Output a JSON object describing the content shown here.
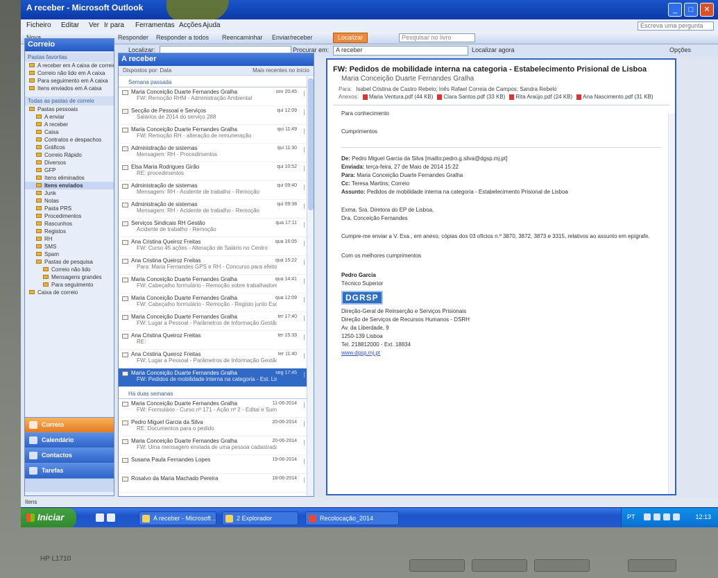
{
  "window": {
    "title": "A receber - Microsoft Outlook"
  },
  "menubar": {
    "items": [
      "Ficheiro",
      "Editar",
      "Ver",
      "Ir para",
      "Ferramentas",
      "Acções",
      "Ajuda"
    ],
    "help_placeholder": "Escreva uma pergunta"
  },
  "toolbar": {
    "new_label": "Nova",
    "reply_label": "Responder",
    "reply_all_label": "Responder a todos",
    "forward_label": "Reencaminhar",
    "send_receive_label": "Enviar/receber",
    "active_label": "Localizar",
    "search_placeholder": "Pesquisar no livro"
  },
  "findbar": {
    "search_label": "Localizar:",
    "search_in_label": "Procurar em:",
    "search_in_value": "A receber",
    "find_now_label": "Localizar agora",
    "options_label": "Opções"
  },
  "nav": {
    "header": "Correio",
    "favorites_title": "Pastas favoritas",
    "favorites": [
      "A receber em A caixa de correio",
      "Correio não lido em A caixa",
      "Para seguimento em A caixa",
      "Itens enviados em A caixa"
    ],
    "all_folders_title": "Todas as pastas de correio",
    "tree": [
      "Pastas pessoais",
      "A enviar",
      "A receber",
      "Caixa",
      "Contratos e despachos",
      "Gráficos",
      "Correio Rápido",
      "Diversos",
      "GFP",
      "Itens eliminados",
      "Itens enviados",
      "Junk",
      "Notas",
      "Pasta PRS",
      "Procedimentos",
      "Rascunhos",
      "Registos",
      "RH",
      "SMS",
      "Spam",
      "Pastas de pesquisa",
      "Correio não lido",
      "Mensagens grandes",
      "Para seguimento",
      "Caixa de correio"
    ],
    "selected_index": 10,
    "buttons": [
      "Correio",
      "Calendário",
      "Contactos",
      "Tarefas"
    ]
  },
  "list": {
    "header": "A receber",
    "arrange_label": "Dispostos por: Data",
    "sort_label": "Mais recentes no início",
    "groups": [
      {
        "label": "Semana passada",
        "messages": [
          {
            "from": "Maria Conceição Duarte Fernandes Gralha",
            "subject": "FW: Remoção RHM - Administração Ambiental",
            "date": "sex 20:45"
          },
          {
            "from": "Secção de Pessoal e Serviços",
            "subject": "Salários de 2014 do serviço 288",
            "date": "qui 12:09"
          },
          {
            "from": "Maria Conceição Duarte Fernandes Gralha",
            "subject": "FW: Remoção RH - alteração de remuneração",
            "date": "qui 11:49"
          },
          {
            "from": "Administração de sistemas",
            "subject": "Mensagem: RH - Procedimentos",
            "date": "qui 11:30"
          },
          {
            "from": "Elsa Maria Rodrigues Girão",
            "subject": "RE: procedimentos",
            "date": "qui 10:52"
          },
          {
            "from": "Administração de sistemas",
            "subject": "Mensagem: RH - Acidente de trabalho - Remoção",
            "date": "qui 09:40"
          },
          {
            "from": "Administração de sistemas",
            "subject": "Mensagem: RH - Acidente de trabalho - Remoção",
            "date": "qui 09:38"
          },
          {
            "from": "Serviços Sindicais RH Gestão",
            "subject": "Acidente de trabalho - Remoção",
            "date": "qua 17:11"
          },
          {
            "from": "Ana Cristina Queiroz Freitas",
            "subject": "FW: Curso 45 ações - Alteração de Salário no Centro",
            "date": "qua 16:05"
          },
          {
            "from": "Ana Cristina Queiroz Freitas",
            "subject": "Para: Maria Fernandes GPS e RH - Concurso para efeito",
            "date": "qua 15:22"
          },
          {
            "from": "Maria Conceição Duarte Fernandes Gralha",
            "subject": "FW: Cabeçalho formulário - Remoção sobre trabalhadores RH",
            "date": "qua 14:41"
          },
          {
            "from": "Maria Conceição Duarte Fernandes Gralha",
            "subject": "FW: Cabeçalho formulário - Remoção - Registo junto Escop",
            "date": "qua 12:09"
          },
          {
            "from": "Maria Conceição Duarte Fernandes Gralha",
            "subject": "FW: Lugar a Pessoal - Parâmetros de Informação Gestão",
            "date": "ter 17:40"
          },
          {
            "from": "Ana Cristina Queiroz Freitas",
            "subject": "RE:",
            "date": "ter 15:33"
          },
          {
            "from": "Ana Cristina Queiroz Freitas",
            "subject": "FW: Lugar a Pessoal - Parâmetros de Informação Gestão",
            "date": "ter 11:40"
          },
          {
            "from": "Maria Conceição Duarte Fernandes Gralha",
            "subject": "FW: Pedidos de mobilidade interna na categoria - Est. Lisboa",
            "date": "seg 17:45",
            "selected": true
          }
        ]
      },
      {
        "label": "Há duas semanas",
        "messages": [
          {
            "from": "Maria Conceição Duarte Fernandes Gralha",
            "subject": "FW: Formulário - Curso nº 171 - Ação nº 2 - Edital e Sum",
            "date": "11-06-2014"
          },
          {
            "from": "Pedro Miguel Garcia da Silva",
            "subject": "RE: Documentos para o pedido",
            "date": "20-06-2014"
          },
          {
            "from": "Maria Conceição Duarte Fernandes Gralha",
            "subject": "FW: Uma mensagem enviada de uma pessoa cadastrada em RH",
            "date": "20-06-2014"
          },
          {
            "from": "Susana Paula Fernandes Lopes",
            "subject": "",
            "date": "19-06-2014"
          },
          {
            "from": "Rosalvo da Maria Machado Pereira",
            "subject": "",
            "date": "18-06-2014"
          }
        ]
      }
    ]
  },
  "reading": {
    "title": "FW: Pedidos de mobilidade interna na categoria - Estabelecimento Prisional de Lisboa",
    "from": "Maria Conceição Duarte Fernandes Gralha",
    "to_label": "Para:",
    "to": "Isabel Cristina de Castro Rebelo; Inês Rafael Correia de Campos; Sandra Rebelo",
    "att_label": "Anexos:",
    "attachments": [
      "Maria Ventura.pdf (44 KB)",
      "Clara Santos.pdf (33 KB)",
      "Rita Araújo.pdf (24 KB)",
      "Ana Nascimento.pdf (31 KB)"
    ],
    "note1": "Para conhecimento",
    "note2": "Cumprimentos",
    "orig_from_label": "De:",
    "orig_from": "Pedro Miguel Garcia da Silva [mailto:pedro.g.silva@dgsp.mj.pt]",
    "orig_sent_label": "Enviada:",
    "orig_sent": "terça-feira, 27 de Maio de 2014 15:22",
    "orig_to_label": "Para:",
    "orig_to": "Maria Conceição Duarte Fernandes Gralha",
    "orig_cc_label": "Cc:",
    "orig_cc": "Teresa Martins; Correio",
    "orig_subject_label": "Assunto:",
    "orig_subject": "Pedidos de mobilidade interna na categoria - Estabelecimento Prisional de Lisboa",
    "greeting1": "Exma. Sra. Diretora do EP de Lisboa,",
    "greeting2": "Dra. Conceição Fernandes",
    "body": "Cumpre-me enviar a V. Exa., em anexo, cópias dos 03 ofícios n.º 3870, 3872, 3873 e 3315, relativos ao assunto em epígrafe.",
    "closing": "Com os melhores cumprimentos",
    "sig_name": "Pedro Garcia",
    "sig_role": "Técnico Superior",
    "sig_logo": "DGRSP",
    "sig_lines": [
      "Direção-Geral de Reinserção e Serviços Prisionais",
      "Direção de Serviços de Recursos Humanos - DSRH",
      "Av. da Liberdade, 9",
      "1250-139 Lisboa",
      "Tel. 218812000 - Ext. 18834"
    ],
    "sig_link": "www.dgsp.mj.pt"
  },
  "status": {
    "text": "Itens"
  },
  "taskbar": {
    "start_label": "Iniciar",
    "tasks": [
      "A receber - Microsoft ...",
      "2 Explorador",
      "Recolocação_2014"
    ],
    "lang": "PT",
    "clock": "12:13"
  },
  "monitor": {
    "brand": "HP L1710"
  }
}
